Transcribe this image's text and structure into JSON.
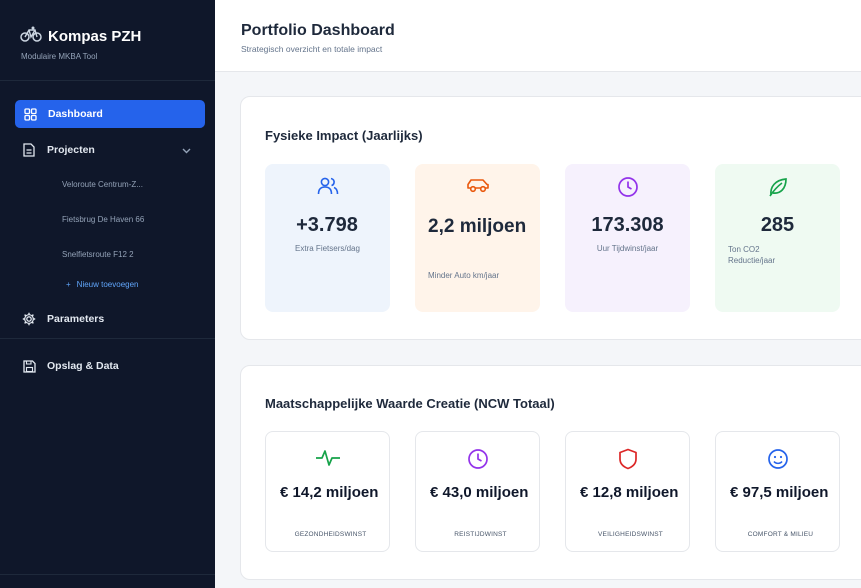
{
  "sidebar": {
    "title": "Kompas PZH",
    "subtitle": "Modulaire MKBA Tool",
    "items": [
      {
        "label": "Dashboard",
        "icon": "grid-icon"
      },
      {
        "label": "Projecten",
        "icon": "document-icon"
      },
      {
        "label": "Parameters",
        "icon": "gear-icon"
      },
      {
        "label": "Opslag & Data",
        "icon": "save-icon"
      }
    ],
    "projects": [
      "Veloroute Centrum-Z...",
      "Fietsbrug De Haven 66",
      "Snelfietsroute F12 2"
    ],
    "add_label": "Nieuw toevoegen",
    "add_symbol": "+"
  },
  "header": {
    "title": "Portfolio Dashboard",
    "subtitle": "Strategisch overzicht en totale impact"
  },
  "impact": {
    "title": "Fysieke Impact (Jaarlijks)",
    "cards": [
      {
        "value": "+3.798",
        "label": "Extra Fietsers/dag",
        "icon": "users-icon",
        "bg": "#eef4fc",
        "accent": "#2563eb"
      },
      {
        "value": "2,2 miljoen",
        "label": "Minder Auto km/jaar",
        "icon": "car-icon",
        "bg": "#fff4ea",
        "accent": "#ea580c"
      },
      {
        "value": "173.308",
        "label": "Uur Tijdwinst/jaar",
        "icon": "clock-icon",
        "bg": "#f6f1fd",
        "accent": "#9333ea"
      },
      {
        "value": "285",
        "label": "Ton CO2 Reductie/jaar",
        "icon": "leaf-icon",
        "bg": "#effaf2",
        "accent": "#16a34a"
      }
    ]
  },
  "value": {
    "title": "Maatschappelijke Waarde Creatie (NCW Totaal)",
    "cards": [
      {
        "amount": "€ 14,2 miljoen",
        "label": "GEZONDHEIDSWINST",
        "icon": "heartbeat-icon",
        "accent": "#16a34a"
      },
      {
        "amount": "€ 43,0 miljoen",
        "label": "REISTIJDWINST",
        "icon": "clock-icon",
        "accent": "#9333ea"
      },
      {
        "amount": "€ 12,8 miljoen",
        "label": "VEILIGHEIDSWINST",
        "icon": "shield-icon",
        "accent": "#dc2626"
      },
      {
        "amount": "€ 97,5 miljoen",
        "label": "COMFORT & MILIEU",
        "icon": "smile-icon",
        "accent": "#2563eb"
      }
    ]
  }
}
